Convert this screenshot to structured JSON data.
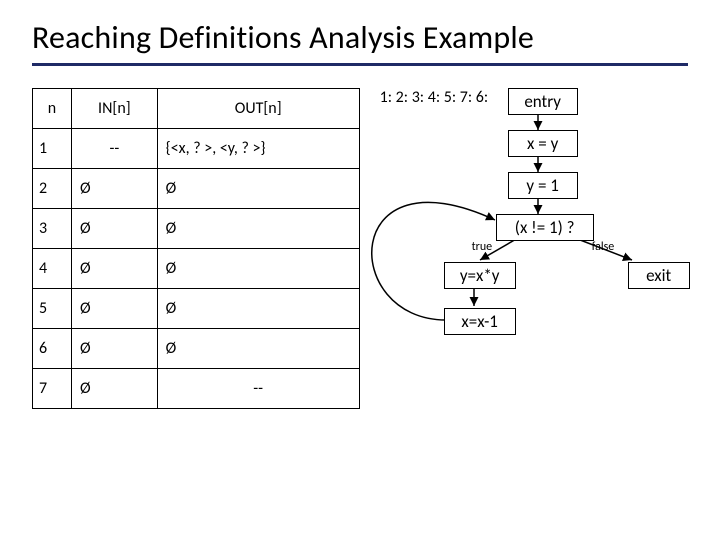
{
  "title": "Reaching Definitions Analysis Example",
  "table": {
    "headers": {
      "n": "n",
      "in": "IN[n]",
      "out": "OUT[n]"
    },
    "rows": [
      {
        "n": "1",
        "in": "--",
        "out": "{<x, ? >, <y, ? >}"
      },
      {
        "n": "2",
        "in": "Ø",
        "out": "Ø"
      },
      {
        "n": "3",
        "in": "Ø",
        "out": "Ø"
      },
      {
        "n": "4",
        "in": "Ø",
        "out": "Ø"
      },
      {
        "n": "5",
        "in": "Ø",
        "out": "Ø"
      },
      {
        "n": "6",
        "in": "Ø",
        "out": "Ø"
      },
      {
        "n": "7",
        "in": "Ø",
        "out": "--"
      }
    ]
  },
  "cfg": {
    "nodes": {
      "n1": {
        "label": "1:",
        "text": "entry"
      },
      "n2": {
        "label": "2:",
        "text": "x = y"
      },
      "n3": {
        "label": "3:",
        "text": "y = 1"
      },
      "n4": {
        "label": "4:",
        "text": "(x != 1) ?"
      },
      "n5": {
        "label": "5:",
        "text": "y=x*y"
      },
      "n6": {
        "label": "6:",
        "text": "x=x-1"
      },
      "n7": {
        "label": "7:",
        "text": "exit"
      }
    },
    "edge_labels": {
      "true": "true",
      "false": "false"
    }
  },
  "chart_data": {
    "type": "table",
    "title": "Reaching Definitions Analysis Example",
    "columns": [
      "n",
      "IN[n]",
      "OUT[n]"
    ],
    "rows": [
      [
        "1",
        "--",
        "{<x,?>,<y,?>}"
      ],
      [
        "2",
        "Ø",
        "Ø"
      ],
      [
        "3",
        "Ø",
        "Ø"
      ],
      [
        "4",
        "Ø",
        "Ø"
      ],
      [
        "5",
        "Ø",
        "Ø"
      ],
      [
        "6",
        "Ø",
        "Ø"
      ],
      [
        "7",
        "Ø",
        "--"
      ]
    ],
    "cfg_edges": [
      [
        "1",
        "2"
      ],
      [
        "2",
        "3"
      ],
      [
        "3",
        "4"
      ],
      [
        "4",
        "5",
        "true"
      ],
      [
        "4",
        "7",
        "false"
      ],
      [
        "5",
        "6"
      ],
      [
        "6",
        "4"
      ]
    ],
    "cfg_node_text": {
      "1": "entry",
      "2": "x = y",
      "3": "y = 1",
      "4": "(x != 1) ?",
      "5": "y=x*y",
      "6": "x=x-1",
      "7": "exit"
    }
  }
}
